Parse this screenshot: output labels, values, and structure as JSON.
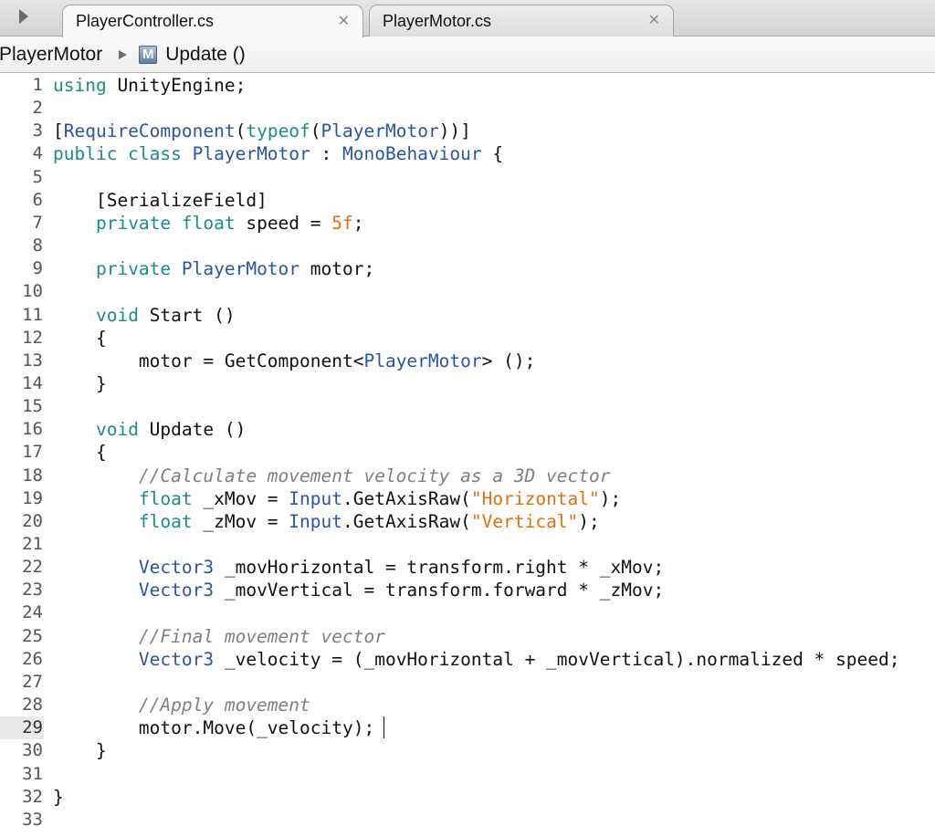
{
  "tabs": [
    {
      "label": "PlayerController.cs",
      "active": true,
      "close": "✕"
    },
    {
      "label": "PlayerMotor.cs",
      "active": false,
      "close": "✕"
    }
  ],
  "breadcrumb": {
    "class_name": "PlayerMotor",
    "method_icon": "M",
    "method_name": "Update ()"
  },
  "editor": {
    "current_line": 29,
    "lines": [
      {
        "n": "1",
        "tokens": [
          [
            "keyword",
            "using"
          ],
          [
            "plain",
            " UnityEngine;"
          ]
        ]
      },
      {
        "n": "2",
        "tokens": []
      },
      {
        "n": "3",
        "tokens": [
          [
            "plain",
            "["
          ],
          [
            "type",
            "RequireComponent"
          ],
          [
            "plain",
            "("
          ],
          [
            "keyword",
            "typeof"
          ],
          [
            "plain",
            "("
          ],
          [
            "type",
            "PlayerMotor"
          ],
          [
            "plain",
            "))]"
          ]
        ]
      },
      {
        "n": "4",
        "tokens": [
          [
            "keyword",
            "public class "
          ],
          [
            "type",
            "PlayerMotor"
          ],
          [
            "plain",
            " : "
          ],
          [
            "type",
            "MonoBehaviour"
          ],
          [
            "plain",
            " {"
          ]
        ]
      },
      {
        "n": "5",
        "tokens": []
      },
      {
        "n": "6",
        "tokens": [
          [
            "plain",
            "    [SerializeField]"
          ]
        ]
      },
      {
        "n": "7",
        "tokens": [
          [
            "plain",
            "    "
          ],
          [
            "keyword",
            "private float"
          ],
          [
            "plain",
            " speed = "
          ],
          [
            "number",
            "5f"
          ],
          [
            "plain",
            ";"
          ]
        ]
      },
      {
        "n": "8",
        "tokens": []
      },
      {
        "n": "9",
        "tokens": [
          [
            "plain",
            "    "
          ],
          [
            "keyword",
            "private "
          ],
          [
            "type",
            "PlayerMotor"
          ],
          [
            "plain",
            " motor;"
          ]
        ]
      },
      {
        "n": "10",
        "tokens": []
      },
      {
        "n": "11",
        "tokens": [
          [
            "plain",
            "    "
          ],
          [
            "keyword",
            "void"
          ],
          [
            "plain",
            " Start ()"
          ]
        ]
      },
      {
        "n": "12",
        "tokens": [
          [
            "plain",
            "    {"
          ]
        ]
      },
      {
        "n": "13",
        "tokens": [
          [
            "plain",
            "        motor = GetComponent<"
          ],
          [
            "type",
            "PlayerMotor"
          ],
          [
            "plain",
            "> ();"
          ]
        ]
      },
      {
        "n": "14",
        "tokens": [
          [
            "plain",
            "    }"
          ]
        ]
      },
      {
        "n": "15",
        "tokens": []
      },
      {
        "n": "16",
        "tokens": [
          [
            "plain",
            "    "
          ],
          [
            "keyword",
            "void"
          ],
          [
            "plain",
            " Update ()"
          ]
        ]
      },
      {
        "n": "17",
        "tokens": [
          [
            "plain",
            "    {"
          ]
        ]
      },
      {
        "n": "18",
        "tokens": [
          [
            "plain",
            "        "
          ],
          [
            "comment",
            "//Calculate movement velocity as a 3D vector"
          ]
        ]
      },
      {
        "n": "19",
        "tokens": [
          [
            "plain",
            "        "
          ],
          [
            "keyword",
            "float"
          ],
          [
            "plain",
            " _xMov = "
          ],
          [
            "type",
            "Input"
          ],
          [
            "plain",
            ".GetAxisRaw("
          ],
          [
            "string",
            "\"Horizontal\""
          ],
          [
            "plain",
            ");"
          ]
        ]
      },
      {
        "n": "20",
        "tokens": [
          [
            "plain",
            "        "
          ],
          [
            "keyword",
            "float"
          ],
          [
            "plain",
            " _zMov = "
          ],
          [
            "type",
            "Input"
          ],
          [
            "plain",
            ".GetAxisRaw("
          ],
          [
            "string",
            "\"Vertical\""
          ],
          [
            "plain",
            ");"
          ]
        ]
      },
      {
        "n": "21",
        "tokens": []
      },
      {
        "n": "22",
        "tokens": [
          [
            "plain",
            "        "
          ],
          [
            "type",
            "Vector3"
          ],
          [
            "plain",
            " _movHorizontal = transform.right * _xMov;"
          ]
        ]
      },
      {
        "n": "23",
        "tokens": [
          [
            "plain",
            "        "
          ],
          [
            "type",
            "Vector3"
          ],
          [
            "plain",
            " _movVertical = transform.forward * _zMov;"
          ]
        ]
      },
      {
        "n": "24",
        "tokens": []
      },
      {
        "n": "25",
        "tokens": [
          [
            "plain",
            "        "
          ],
          [
            "comment",
            "//Final movement vector"
          ]
        ]
      },
      {
        "n": "26",
        "tokens": [
          [
            "plain",
            "        "
          ],
          [
            "type",
            "Vector3"
          ],
          [
            "plain",
            " _velocity = (_movHorizontal + _movVertical).normalized * speed;"
          ]
        ]
      },
      {
        "n": "27",
        "tokens": []
      },
      {
        "n": "28",
        "tokens": [
          [
            "plain",
            "        "
          ],
          [
            "comment",
            "//Apply movement"
          ]
        ]
      },
      {
        "n": "29",
        "tokens": [
          [
            "plain",
            "        motor.Move(_velocity);"
          ]
        ]
      },
      {
        "n": "30",
        "tokens": [
          [
            "plain",
            "    }"
          ]
        ]
      },
      {
        "n": "31",
        "tokens": []
      },
      {
        "n": "32",
        "tokens": [
          [
            "plain",
            "}"
          ]
        ]
      },
      {
        "n": "33",
        "tokens": []
      }
    ]
  }
}
